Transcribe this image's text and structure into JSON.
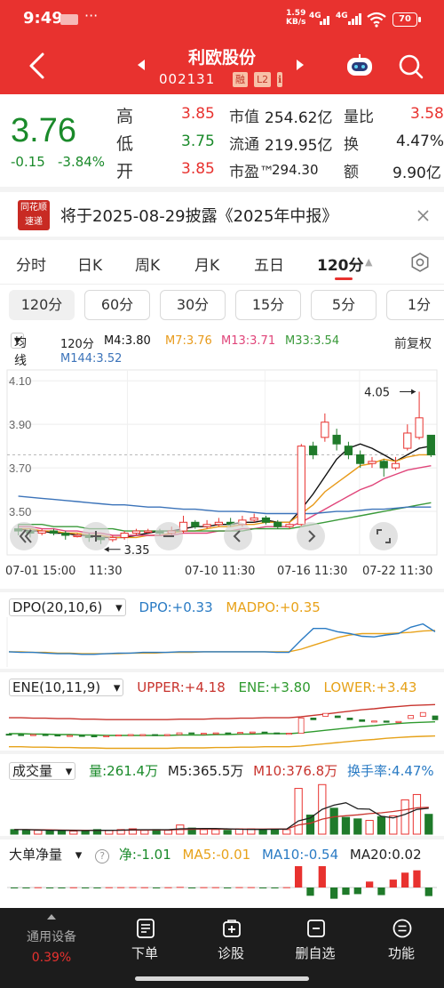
{
  "status_bar": {
    "time": "9:49",
    "dots": "···",
    "net_speed": "1.59",
    "net_unit": "KB/s",
    "sig1": "4G",
    "sig2": "4G",
    "battery": "70"
  },
  "nav": {
    "back_icon": "chevron-left-icon",
    "title": "利欧股份",
    "code": "002131",
    "tags": [
      "融",
      "L2",
      "ℹ"
    ],
    "prev_icon": "triangle-left-icon",
    "next_icon": "triangle-right-icon",
    "robot_icon": "robot-icon",
    "search_icon": "search-icon"
  },
  "quote": {
    "price": "3.76",
    "change": "-0.15",
    "change_pct": "-3.84%",
    "fields": [
      {
        "label": "高",
        "value": "3.85"
      },
      {
        "label": "低",
        "value": "3.75"
      },
      {
        "label": "开",
        "value": "3.85"
      },
      {
        "label": "市值",
        "value": "254.62亿"
      },
      {
        "label": "流通",
        "value": "219.95亿"
      },
      {
        "label": "市盈™",
        "value": "294.30"
      },
      {
        "label": "量比",
        "value": "3.58"
      },
      {
        "label": "换",
        "value": "4.47%"
      },
      {
        "label": "额",
        "value": "9.90亿"
      }
    ]
  },
  "notice": {
    "logo_line1": "同花顺",
    "logo_line2": "速递",
    "text": "将于2025-08-29披露《2025年中报》",
    "close_icon": "close-icon"
  },
  "period_tabs": [
    "分时",
    "日K",
    "周K",
    "月K",
    "五日",
    "120分"
  ],
  "active_period": "120分",
  "period_caret": "▲",
  "settings_icon": "gear-icon",
  "sub_tabs": [
    "120分",
    "60分",
    "30分",
    "15分",
    "5分",
    "1分"
  ],
  "legend": {
    "selector": "均线",
    "period": "120分",
    "m4": "M4:3.80",
    "m7": "M7:3.76",
    "m13": "M13:3.71",
    "m33": "M33:3.54",
    "m144": "M144:3.52",
    "adjust": "前复权"
  },
  "chart_data": {
    "type": "candlestick",
    "y_ticks": [
      "4.10",
      "3.90",
      "3.70",
      "3.50"
    ],
    "x_labels": [
      "07-01 15:00",
      "11:30",
      "07-10 11:30",
      "07-16 11:30",
      "07-22 11:30"
    ],
    "high_marker": "4.05",
    "low_marker": "3.35",
    "ylim": [
      3.3,
      4.15
    ],
    "candles": [
      {
        "o": 3.42,
        "c": 3.41,
        "h": 3.44,
        "l": 3.39
      },
      {
        "o": 3.41,
        "c": 3.4,
        "h": 3.42,
        "l": 3.38
      },
      {
        "o": 3.4,
        "c": 3.41,
        "h": 3.42,
        "l": 3.39
      },
      {
        "o": 3.41,
        "c": 3.4,
        "h": 3.42,
        "l": 3.39
      },
      {
        "o": 3.4,
        "c": 3.39,
        "h": 3.41,
        "l": 3.37
      },
      {
        "o": 3.39,
        "c": 3.39,
        "h": 3.4,
        "l": 3.38
      },
      {
        "o": 3.39,
        "c": 3.38,
        "h": 3.4,
        "l": 3.36
      },
      {
        "o": 3.38,
        "c": 3.37,
        "h": 3.39,
        "l": 3.35
      },
      {
        "o": 3.37,
        "c": 3.38,
        "h": 3.39,
        "l": 3.36
      },
      {
        "o": 3.38,
        "c": 3.4,
        "h": 3.41,
        "l": 3.37
      },
      {
        "o": 3.4,
        "c": 3.41,
        "h": 3.42,
        "l": 3.39
      },
      {
        "o": 3.41,
        "c": 3.41,
        "h": 3.42,
        "l": 3.4
      },
      {
        "o": 3.41,
        "c": 3.4,
        "h": 3.42,
        "l": 3.39
      },
      {
        "o": 3.4,
        "c": 3.41,
        "h": 3.43,
        "l": 3.39
      },
      {
        "o": 3.41,
        "c": 3.45,
        "h": 3.48,
        "l": 3.4
      },
      {
        "o": 3.45,
        "c": 3.43,
        "h": 3.46,
        "l": 3.42
      },
      {
        "o": 3.43,
        "c": 3.44,
        "h": 3.46,
        "l": 3.42
      },
      {
        "o": 3.44,
        "c": 3.45,
        "h": 3.47,
        "l": 3.43
      },
      {
        "o": 3.45,
        "c": 3.44,
        "h": 3.47,
        "l": 3.43
      },
      {
        "o": 3.44,
        "c": 3.46,
        "h": 3.48,
        "l": 3.43
      },
      {
        "o": 3.46,
        "c": 3.47,
        "h": 3.49,
        "l": 3.45
      },
      {
        "o": 3.47,
        "c": 3.45,
        "h": 3.48,
        "l": 3.44
      },
      {
        "o": 3.45,
        "c": 3.43,
        "h": 3.46,
        "l": 3.42
      },
      {
        "o": 3.43,
        "c": 3.44,
        "h": 3.45,
        "l": 3.42
      },
      {
        "o": 3.44,
        "c": 3.8,
        "h": 3.81,
        "l": 3.43
      },
      {
        "o": 3.8,
        "c": 3.76,
        "h": 3.82,
        "l": 3.74
      },
      {
        "o": 3.84,
        "c": 3.91,
        "h": 3.95,
        "l": 3.82
      },
      {
        "o": 3.85,
        "c": 3.81,
        "h": 3.88,
        "l": 3.78
      },
      {
        "o": 3.8,
        "c": 3.76,
        "h": 3.82,
        "l": 3.74
      },
      {
        "o": 3.76,
        "c": 3.72,
        "h": 3.78,
        "l": 3.7
      },
      {
        "o": 3.72,
        "c": 3.73,
        "h": 3.75,
        "l": 3.7
      },
      {
        "o": 3.73,
        "c": 3.7,
        "h": 3.74,
        "l": 3.66
      },
      {
        "o": 3.7,
        "c": 3.72,
        "h": 3.75,
        "l": 3.69
      },
      {
        "o": 3.79,
        "c": 3.86,
        "h": 3.9,
        "l": 3.78
      },
      {
        "o": 3.84,
        "c": 3.93,
        "h": 4.05,
        "l": 3.83
      },
      {
        "o": 3.85,
        "c": 3.76,
        "h": 3.85,
        "l": 3.75
      }
    ],
    "ma_lines": [
      {
        "name": "M4",
        "color": "#111111",
        "values": [
          3.42,
          3.41,
          3.41,
          3.4,
          3.4,
          3.39,
          3.39,
          3.38,
          3.38,
          3.38,
          3.39,
          3.4,
          3.41,
          3.41,
          3.42,
          3.43,
          3.43,
          3.44,
          3.44,
          3.45,
          3.45,
          3.46,
          3.45,
          3.45,
          3.51,
          3.58,
          3.66,
          3.74,
          3.79,
          3.81,
          3.79,
          3.76,
          3.73,
          3.76,
          3.79,
          3.8
        ]
      },
      {
        "name": "M7",
        "color": "#e89a1a",
        "values": [
          3.42,
          3.42,
          3.41,
          3.41,
          3.4,
          3.4,
          3.39,
          3.39,
          3.38,
          3.38,
          3.38,
          3.39,
          3.39,
          3.4,
          3.41,
          3.41,
          3.42,
          3.43,
          3.43,
          3.44,
          3.44,
          3.45,
          3.45,
          3.45,
          3.49,
          3.53,
          3.59,
          3.63,
          3.67,
          3.71,
          3.72,
          3.74,
          3.73,
          3.75,
          3.76,
          3.76
        ]
      },
      {
        "name": "M13",
        "color": "#e0457a",
        "values": [
          3.43,
          3.43,
          3.42,
          3.42,
          3.41,
          3.41,
          3.4,
          3.4,
          3.39,
          3.39,
          3.39,
          3.39,
          3.39,
          3.39,
          3.4,
          3.4,
          3.4,
          3.41,
          3.41,
          3.42,
          3.42,
          3.43,
          3.43,
          3.43,
          3.45,
          3.48,
          3.51,
          3.54,
          3.57,
          3.6,
          3.62,
          3.65,
          3.67,
          3.69,
          3.7,
          3.71
        ]
      },
      {
        "name": "M33",
        "color": "#3a9a3a",
        "values": [
          3.44,
          3.44,
          3.44,
          3.43,
          3.43,
          3.43,
          3.42,
          3.42,
          3.42,
          3.41,
          3.41,
          3.41,
          3.41,
          3.41,
          3.41,
          3.41,
          3.41,
          3.41,
          3.41,
          3.41,
          3.42,
          3.42,
          3.42,
          3.42,
          3.43,
          3.44,
          3.45,
          3.46,
          3.47,
          3.48,
          3.49,
          3.5,
          3.51,
          3.52,
          3.53,
          3.54
        ]
      },
      {
        "name": "M144",
        "color": "#3b73b9",
        "values": [
          3.57,
          3.565,
          3.56,
          3.555,
          3.55,
          3.545,
          3.54,
          3.535,
          3.53,
          3.53,
          3.525,
          3.52,
          3.52,
          3.515,
          3.51,
          3.51,
          3.505,
          3.5,
          3.5,
          3.5,
          3.495,
          3.49,
          3.49,
          3.49,
          3.49,
          3.49,
          3.495,
          3.5,
          3.5,
          3.505,
          3.51,
          3.51,
          3.515,
          3.52,
          3.52,
          3.52
        ]
      }
    ]
  },
  "chart_controls": {
    "rewind_icon": "double-chevron-left-icon",
    "zoom_in_icon": "plus-icon",
    "zoom_out_icon": "minus-icon",
    "prev_icon": "chevron-left-icon",
    "next_icon": "chevron-right-icon",
    "fullscreen_icon": "expand-icon"
  },
  "dpo": {
    "name": "DPO(20,10,6)",
    "dpo": "DPO:+0.33",
    "madpo": "MADPO:+0.35",
    "dpo_color": "#2a7bc4",
    "madpo_color": "#e8a21a",
    "dpo_values": [
      0.02,
      0.01,
      0.01,
      0.0,
      -0.01,
      -0.01,
      -0.02,
      -0.02,
      -0.01,
      0.0,
      0.0,
      0.01,
      0.01,
      0.01,
      0.02,
      0.02,
      0.02,
      0.02,
      0.02,
      0.02,
      0.02,
      0.02,
      0.01,
      0.01,
      0.2,
      0.38,
      0.38,
      0.33,
      0.3,
      0.26,
      0.25,
      0.28,
      0.3,
      0.4,
      0.45,
      0.33
    ],
    "madpo_values": [
      0.02,
      0.02,
      0.01,
      0.01,
      0.0,
      0.0,
      -0.01,
      -0.01,
      -0.01,
      -0.01,
      0.0,
      0.0,
      0.0,
      0.01,
      0.01,
      0.01,
      0.02,
      0.02,
      0.02,
      0.02,
      0.02,
      0.02,
      0.02,
      0.02,
      0.06,
      0.12,
      0.18,
      0.24,
      0.28,
      0.3,
      0.3,
      0.3,
      0.31,
      0.32,
      0.34,
      0.35
    ]
  },
  "ene": {
    "name": "ENE(10,11,9)",
    "upper": "UPPER:+4.18",
    "ene": "ENE:+3.80",
    "lower": "LOWER:+3.43",
    "colors": {
      "upper": "#c8342e",
      "ene": "#2e9a2e",
      "lower": "#e6a21a"
    }
  },
  "volume": {
    "name": "成交量",
    "amount": "量:261.4万",
    "m5": "M5:365.5万",
    "m10": "M10:376.8万",
    "turnover": "换手率:4.47%",
    "values": [
      0.6,
      0.5,
      0.5,
      0.4,
      0.5,
      0.4,
      0.5,
      0.6,
      0.5,
      0.6,
      0.7,
      0.5,
      0.6,
      0.5,
      1.2,
      0.8,
      0.6,
      0.6,
      0.5,
      0.7,
      0.7,
      0.6,
      0.7,
      0.6,
      6.0,
      2.5,
      6.5,
      3.4,
      2.2,
      2.0,
      1.8,
      2.3,
      2.4,
      4.5,
      5.2,
      2.6
    ],
    "m5_values": [
      0.6,
      0.6,
      0.55,
      0.5,
      0.5,
      0.48,
      0.47,
      0.5,
      0.5,
      0.52,
      0.58,
      0.58,
      0.58,
      0.58,
      0.7,
      0.72,
      0.74,
      0.74,
      0.7,
      0.64,
      0.62,
      0.62,
      0.64,
      0.66,
      1.74,
      2.12,
      3.26,
      3.8,
      4.12,
      3.32,
      3.28,
      2.34,
      2.14,
      2.6,
      3.24,
      3.4
    ],
    "m10_values": [
      0.6,
      0.6,
      0.58,
      0.56,
      0.54,
      0.52,
      0.5,
      0.5,
      0.5,
      0.51,
      0.53,
      0.54,
      0.55,
      0.56,
      0.61,
      0.63,
      0.65,
      0.66,
      0.65,
      0.66,
      0.67,
      0.67,
      0.68,
      0.68,
      1.21,
      1.43,
      1.97,
      2.27,
      2.42,
      2.53,
      2.7,
      2.8,
      2.97,
      3.2,
      3.45,
      3.52
    ]
  },
  "big_order": {
    "name": "大单净量",
    "help_icon": "question-icon",
    "net": "净:-1.01",
    "ma5": "MA5:-0.01",
    "ma10": "MA10:-0.54",
    "ma20": "MA20:0.02"
  },
  "bottom_nav": {
    "device": "通用设备",
    "device_pct": "0.39%",
    "items": [
      {
        "label": "下单",
        "icon": "order-icon"
      },
      {
        "label": "诊股",
        "icon": "diagnose-icon"
      },
      {
        "label": "删自选",
        "icon": "remove-favorite-icon"
      },
      {
        "label": "功能",
        "icon": "menu-icon"
      }
    ]
  }
}
